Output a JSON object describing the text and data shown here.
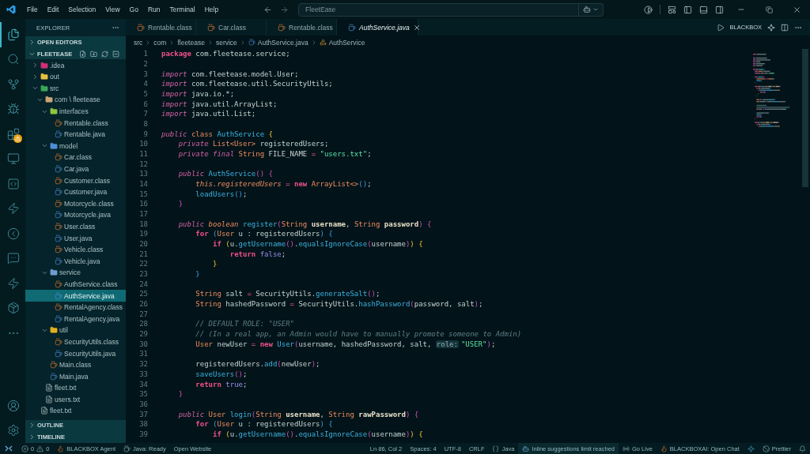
{
  "title_bar": {
    "menu": [
      "File",
      "Edit",
      "Selection",
      "View",
      "Go",
      "Run",
      "Terminal",
      "Help"
    ],
    "search": {
      "value": "FleetEase"
    }
  },
  "activity_bar": [
    {
      "kind": "explorer",
      "selected": true,
      "warning": false
    },
    {
      "kind": "search",
      "selected": false,
      "warning": false
    },
    {
      "kind": "source-control",
      "selected": false,
      "warning": false
    },
    {
      "kind": "debug",
      "selected": false,
      "warning": false
    },
    {
      "kind": "extensions",
      "selected": false,
      "warning": true
    },
    {
      "kind": "remote",
      "selected": false,
      "warning": false
    },
    {
      "kind": "code",
      "selected": false,
      "warning": false
    },
    {
      "kind": "lightning",
      "selected": false,
      "warning": false
    },
    {
      "kind": "blackbox",
      "selected": false,
      "warning": false
    },
    {
      "kind": "chat",
      "selected": false,
      "warning": false
    },
    {
      "kind": "lightning-outline",
      "selected": false,
      "warning": false
    },
    {
      "kind": "box",
      "selected": false,
      "warning": false
    },
    {
      "kind": "more",
      "selected": false,
      "warning": false
    },
    {
      "kind": "account",
      "selected": false,
      "warning": false
    },
    {
      "kind": "settings",
      "selected": false,
      "warning": false
    }
  ],
  "sidebar": {
    "title": "EXPLORER",
    "sections": [
      {
        "title": "OPEN EDITORS",
        "expanded": false
      },
      {
        "title": "FLEETEASE",
        "expanded": true,
        "tree": [
          {
            "name": ".idea",
            "kind": "folder",
            "color": "#d0307a",
            "expanded": false,
            "selected": false
          },
          {
            "name": "out",
            "kind": "folder",
            "color": "#e8c040",
            "expanded": false,
            "selected": false
          },
          {
            "name": "src",
            "kind": "folder",
            "color": "#3aa65a",
            "expanded": true,
            "selected": false,
            "children": [
              {
                "name": "com \\ fleetease",
                "kind": "folder",
                "color": "#c9a57a",
                "expanded": true,
                "selected": false,
                "children": [
                  {
                    "name": "interfaces",
                    "kind": "folder",
                    "color": "#8cc63f",
                    "expanded": true,
                    "selected": false,
                    "children": [
                      {
                        "name": "Rentable.class",
                        "kind": "class",
                        "selected": false
                      },
                      {
                        "name": "Rentable.java",
                        "kind": "java",
                        "selected": false
                      }
                    ]
                  },
                  {
                    "name": "model",
                    "kind": "folder",
                    "color": "#4f8fd8",
                    "expanded": true,
                    "selected": false,
                    "children": [
                      {
                        "name": "Car.class",
                        "kind": "class",
                        "selected": false
                      },
                      {
                        "name": "Car.java",
                        "kind": "java",
                        "selected": false
                      },
                      {
                        "name": "Customer.class",
                        "kind": "class",
                        "selected": false
                      },
                      {
                        "name": "Customer.java",
                        "kind": "java",
                        "selected": false
                      },
                      {
                        "name": "Motorcycle.class",
                        "kind": "class",
                        "selected": false
                      },
                      {
                        "name": "Motorcycle.java",
                        "kind": "java",
                        "selected": false
                      },
                      {
                        "name": "User.class",
                        "kind": "class",
                        "selected": false
                      },
                      {
                        "name": "User.java",
                        "kind": "java",
                        "selected": false
                      },
                      {
                        "name": "Vehicle.class",
                        "kind": "class",
                        "selected": false
                      },
                      {
                        "name": "Vehicle.java",
                        "kind": "java",
                        "selected": false
                      }
                    ]
                  },
                  {
                    "name": "service",
                    "kind": "folder",
                    "color": "#6d9fd0",
                    "expanded": true,
                    "selected": false,
                    "children": [
                      {
                        "name": "AuthService.class",
                        "kind": "class",
                        "selected": false
                      },
                      {
                        "name": "AuthService.java",
                        "kind": "java",
                        "selected": true
                      },
                      {
                        "name": "RentalAgency.class",
                        "kind": "class",
                        "selected": false
                      },
                      {
                        "name": "RentalAgency.java",
                        "kind": "java",
                        "selected": false
                      }
                    ]
                  },
                  {
                    "name": "util",
                    "kind": "folder",
                    "color": "#e0b020",
                    "expanded": true,
                    "selected": false,
                    "children": [
                      {
                        "name": "SecurityUtils.class",
                        "kind": "class",
                        "selected": false
                      },
                      {
                        "name": "SecurityUtils.java",
                        "kind": "java",
                        "selected": false
                      }
                    ]
                  },
                  {
                    "name": "Main.class",
                    "kind": "class",
                    "selected": false
                  },
                  {
                    "name": "Main.java",
                    "kind": "java",
                    "selected": false
                  }
                ]
              },
              {
                "name": "fleet.txt",
                "kind": "txt",
                "selected": false
              },
              {
                "name": "users.txt",
                "kind": "txt",
                "selected": false
              }
            ]
          },
          {
            "name": "fleet.txt",
            "kind": "txt",
            "selected": false
          }
        ]
      },
      {
        "title": "OUTLINE",
        "expanded": false
      },
      {
        "title": "TIMELINE",
        "expanded": false
      }
    ]
  },
  "tabs": [
    {
      "label": "Rentable.class",
      "kind": "class",
      "selected": false
    },
    {
      "label": "Car.class",
      "kind": "class",
      "selected": false
    },
    {
      "label": "Rentable.class",
      "kind": "class",
      "selected": false
    },
    {
      "label": "AuthService.java",
      "kind": "java",
      "selected": true
    }
  ],
  "editor_actions": {
    "label": "BLACKBOX"
  },
  "breadcrumb": [
    {
      "label": "src",
      "kind": "folder"
    },
    {
      "label": "com",
      "kind": "folder"
    },
    {
      "label": "fleetease",
      "kind": "folder"
    },
    {
      "label": "service",
      "kind": "folder"
    },
    {
      "label": "AuthService.java",
      "kind": "java"
    },
    {
      "label": "AuthService",
      "kind": "symbol"
    }
  ],
  "code": [
    {
      "n": "1",
      "tokens": [
        {
          "kind": "kw",
          "text": "package"
        },
        {
          "kind": "id",
          "text": " com.fleetease.service;"
        }
      ]
    },
    {
      "n": "2"
    },
    {
      "n": "3",
      "tokens": [
        {
          "kind": "mod",
          "text": "import"
        },
        {
          "kind": "id",
          "text": " com.fleetease.model.User;"
        }
      ]
    },
    {
      "n": "4",
      "tokens": [
        {
          "kind": "mod",
          "text": "import"
        },
        {
          "kind": "id",
          "text": " com.fleetease.util.SecurityUtils;"
        }
      ]
    },
    {
      "n": "5",
      "tokens": [
        {
          "kind": "mod",
          "text": "import"
        },
        {
          "kind": "id",
          "text": " java.io.*;"
        }
      ]
    },
    {
      "n": "6",
      "tokens": [
        {
          "kind": "mod",
          "text": "import"
        },
        {
          "kind": "id",
          "text": " java.util.ArrayList;"
        }
      ]
    },
    {
      "n": "7",
      "tokens": [
        {
          "kind": "mod",
          "text": "import"
        },
        {
          "kind": "id",
          "text": " java.util.List;"
        }
      ]
    },
    {
      "n": "8"
    },
    {
      "n": "9",
      "tokens": [
        {
          "kind": "mod",
          "text": "public"
        },
        {
          "kind": "ty",
          "text": " class"
        },
        {
          "kind": "fn",
          "text": " AuthService"
        },
        {
          "kind": "b1",
          "text": " {"
        }
      ]
    },
    {
      "n": "10",
      "tokens": [
        {
          "kind": "mod",
          "text": "    private"
        },
        {
          "kind": "ty",
          "text": " List<User>"
        },
        {
          "kind": "id",
          "text": " registeredUsers;"
        }
      ]
    },
    {
      "n": "11",
      "tokens": [
        {
          "kind": "mod",
          "text": "    private final"
        },
        {
          "kind": "ty",
          "text": " String"
        },
        {
          "kind": "id",
          "text": " FILE_NAME"
        },
        {
          "kind": "op",
          "text": " ="
        },
        {
          "kind": "str",
          "text": " \"users.txt\""
        },
        {
          "kind": "id",
          "text": ";"
        }
      ]
    },
    {
      "n": "12"
    },
    {
      "n": "13",
      "tokens": [
        {
          "kind": "mod",
          "text": "    public"
        },
        {
          "kind": "fn",
          "text": " AuthService"
        },
        {
          "kind": "b2",
          "text": "() {"
        }
      ]
    },
    {
      "n": "14",
      "tokens": [
        {
          "kind": "tyi",
          "text": "        this.registeredUsers"
        },
        {
          "kind": "op",
          "text": " ="
        },
        {
          "kind": "kw",
          "text": " new"
        },
        {
          "kind": "ty",
          "text": " ArrayList<>"
        },
        {
          "kind": "b3",
          "text": "()"
        },
        {
          "kind": "id",
          "text": ";"
        }
      ]
    },
    {
      "n": "15",
      "tokens": [
        {
          "kind": "fn",
          "text": "        loadUsers"
        },
        {
          "kind": "b3",
          "text": "()"
        },
        {
          "kind": "id",
          "text": ";"
        }
      ]
    },
    {
      "n": "16",
      "tokens": [
        {
          "kind": "b2",
          "text": "    }"
        }
      ]
    },
    {
      "n": "17"
    },
    {
      "n": "18",
      "tokens": [
        {
          "kind": "mod",
          "text": "    public"
        },
        {
          "kind": "tyi",
          "text": " boolean"
        },
        {
          "kind": "fn",
          "text": " register"
        },
        {
          "kind": "b2",
          "text": "("
        },
        {
          "kind": "ty",
          "text": "String"
        },
        {
          "kind": "par",
          "text": " username"
        },
        {
          "kind": "id",
          "text": ","
        },
        {
          "kind": "ty",
          "text": " String"
        },
        {
          "kind": "par",
          "text": " password"
        },
        {
          "kind": "b2",
          "text": ") {"
        }
      ]
    },
    {
      "n": "19",
      "tokens": [
        {
          "kind": "kw",
          "text": "        for"
        },
        {
          "kind": "b3",
          "text": " ("
        },
        {
          "kind": "ty",
          "text": "User"
        },
        {
          "kind": "id",
          "text": " u : registeredUsers"
        },
        {
          "kind": "b3",
          "text": ") {"
        }
      ]
    },
    {
      "n": "20",
      "tokens": [
        {
          "kind": "kw",
          "text": "            if"
        },
        {
          "kind": "b1",
          "text": " ("
        },
        {
          "kind": "id",
          "text": "u."
        },
        {
          "kind": "fn",
          "text": "getUsername"
        },
        {
          "kind": "b2",
          "text": "()"
        },
        {
          "kind": "id",
          "text": "."
        },
        {
          "kind": "fn",
          "text": "equalsIgnoreCase"
        },
        {
          "kind": "b2",
          "text": "("
        },
        {
          "kind": "id",
          "text": "username"
        },
        {
          "kind": "b2",
          "text": ")"
        },
        {
          "kind": "b1",
          "text": ") {"
        }
      ]
    },
    {
      "n": "21",
      "tokens": [
        {
          "kind": "kw",
          "text": "                return"
        },
        {
          "kind": "lit",
          "text": " false"
        },
        {
          "kind": "id",
          "text": ";"
        }
      ]
    },
    {
      "n": "22",
      "tokens": [
        {
          "kind": "b1",
          "text": "            }"
        }
      ]
    },
    {
      "n": "23",
      "tokens": [
        {
          "kind": "b3",
          "text": "        }"
        }
      ]
    },
    {
      "n": "24"
    },
    {
      "n": "25",
      "tokens": [
        {
          "kind": "ty",
          "text": "        String"
        },
        {
          "kind": "id",
          "text": " salt"
        },
        {
          "kind": "op",
          "text": " ="
        },
        {
          "kind": "id",
          "text": " SecurityUtils."
        },
        {
          "kind": "fn",
          "text": "generateSalt"
        },
        {
          "kind": "b2",
          "text": "()"
        },
        {
          "kind": "id",
          "text": ";"
        }
      ]
    },
    {
      "n": "26",
      "tokens": [
        {
          "kind": "ty",
          "text": "        String"
        },
        {
          "kind": "id",
          "text": " hashedPassword"
        },
        {
          "kind": "op",
          "text": " ="
        },
        {
          "kind": "id",
          "text": " SecurityUtils."
        },
        {
          "kind": "fn",
          "text": "hashPassword"
        },
        {
          "kind": "b2",
          "text": "("
        },
        {
          "kind": "id",
          "text": "password, salt"
        },
        {
          "kind": "b2",
          "text": ")"
        },
        {
          "kind": "id",
          "text": ";"
        }
      ]
    },
    {
      "n": "27"
    },
    {
      "n": "28",
      "tokens": [
        {
          "kind": "cmt",
          "text": "        // DEFAULT ROLE: \"USER\""
        }
      ]
    },
    {
      "n": "29",
      "tokens": [
        {
          "kind": "cmt",
          "text": "        // (In a real app, an Admin would have to manually promote someone to Admin)"
        }
      ]
    },
    {
      "n": "30",
      "tokens": [
        {
          "kind": "ty",
          "text": "        User"
        },
        {
          "kind": "id",
          "text": " newUser"
        },
        {
          "kind": "op",
          "text": " ="
        },
        {
          "kind": "kw",
          "text": " new"
        },
        {
          "kind": "fn",
          "text": " User"
        },
        {
          "kind": "b2",
          "text": "("
        },
        {
          "kind": "id",
          "text": "username, hashedPassword, salt, "
        },
        {
          "kind": "hint",
          "text": "role:"
        },
        {
          "kind": "str",
          "text": "\"USER\""
        },
        {
          "kind": "b2",
          "text": ")"
        },
        {
          "kind": "id",
          "text": ";"
        }
      ]
    },
    {
      "n": "31"
    },
    {
      "n": "32",
      "tokens": [
        {
          "kind": "id",
          "text": "        registeredUsers."
        },
        {
          "kind": "fn",
          "text": "add"
        },
        {
          "kind": "b2",
          "text": "("
        },
        {
          "kind": "id",
          "text": "newUser"
        },
        {
          "kind": "b2",
          "text": ")"
        },
        {
          "kind": "id",
          "text": ";"
        }
      ]
    },
    {
      "n": "33",
      "tokens": [
        {
          "kind": "fn",
          "text": "        saveUsers"
        },
        {
          "kind": "b2",
          "text": "()"
        },
        {
          "kind": "id",
          "text": ";"
        }
      ]
    },
    {
      "n": "34",
      "tokens": [
        {
          "kind": "kw",
          "text": "        return"
        },
        {
          "kind": "lit",
          "text": " true"
        },
        {
          "kind": "id",
          "text": ";"
        }
      ]
    },
    {
      "n": "35",
      "tokens": [
        {
          "kind": "b2",
          "text": "    }"
        }
      ]
    },
    {
      "n": "36"
    },
    {
      "n": "37",
      "tokens": [
        {
          "kind": "mod",
          "text": "    public"
        },
        {
          "kind": "ty",
          "text": " User"
        },
        {
          "kind": "fn",
          "text": " login"
        },
        {
          "kind": "b2",
          "text": "("
        },
        {
          "kind": "ty",
          "text": "String"
        },
        {
          "kind": "par",
          "text": " username"
        },
        {
          "kind": "id",
          "text": ","
        },
        {
          "kind": "ty",
          "text": " String"
        },
        {
          "kind": "par",
          "text": " rawPassword"
        },
        {
          "kind": "b2",
          "text": ") {"
        }
      ]
    },
    {
      "n": "38",
      "tokens": [
        {
          "kind": "kw",
          "text": "        for"
        },
        {
          "kind": "b3",
          "text": " ("
        },
        {
          "kind": "ty",
          "text": "User"
        },
        {
          "kind": "id",
          "text": " u : registeredUsers"
        },
        {
          "kind": "b3",
          "text": ") {"
        }
      ]
    },
    {
      "n": "39",
      "tokens": [
        {
          "kind": "kw",
          "text": "            if"
        },
        {
          "kind": "b1",
          "text": " ("
        },
        {
          "kind": "id",
          "text": "u."
        },
        {
          "kind": "fn",
          "text": "getUsername"
        },
        {
          "kind": "b2",
          "text": "()"
        },
        {
          "kind": "id",
          "text": "."
        },
        {
          "kind": "fn",
          "text": "equalsIgnoreCase"
        },
        {
          "kind": "b2",
          "text": "("
        },
        {
          "kind": "id",
          "text": "username"
        },
        {
          "kind": "b2",
          "text": ")"
        },
        {
          "kind": "b1",
          "text": ") {"
        }
      ]
    }
  ],
  "status_bar": {
    "left": [
      {
        "kind": "remote"
      },
      {
        "kind": "problems",
        "errors": "0",
        "warnings": "0"
      },
      {
        "kind": "blackbox",
        "text": "BLACKBOX Agent"
      },
      {
        "kind": "java",
        "text": "Java: Ready"
      },
      {
        "kind": "plain",
        "text": "Open Website"
      }
    ],
    "right": [
      {
        "kind": "plain",
        "text": "Ln 86, Col 2"
      },
      {
        "kind": "plain",
        "text": "Spaces: 4"
      },
      {
        "kind": "plain",
        "text": "UTF-8"
      },
      {
        "kind": "plain",
        "text": "CRLF"
      },
      {
        "kind": "language",
        "text": "Java"
      },
      {
        "kind": "copilot",
        "text": "Inline suggestions limit reached"
      },
      {
        "kind": "live",
        "text": "Go Live"
      },
      {
        "kind": "blackbox",
        "text": "BLACKBOXAI: Open Chat"
      },
      {
        "kind": "sparkle"
      },
      {
        "kind": "prettier",
        "text": "Prettier"
      },
      {
        "kind": "bell"
      }
    ]
  }
}
